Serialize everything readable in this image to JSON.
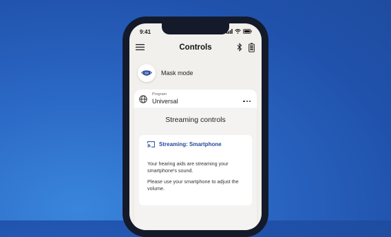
{
  "status_bar": {
    "time": "9:41"
  },
  "header": {
    "title": "Controls"
  },
  "mask": {
    "label": "Mask mode"
  },
  "program": {
    "caption": "Program",
    "value": "Universal"
  },
  "streaming": {
    "title": "Streaming controls",
    "heading": "Streaming: Smartphone",
    "text1": "Your hearing aids are streaming your smartphone's sound.",
    "text2": "Please use your smartphone to adjust the volume."
  },
  "colors": {
    "accent": "#24479a",
    "background": "#2a67c4"
  }
}
